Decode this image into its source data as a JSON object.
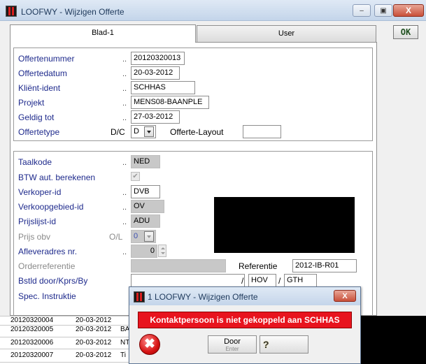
{
  "window": {
    "title": "LOOFWY - Wijzigen Offerte",
    "minimize": "–",
    "restore": "▣",
    "close": "X"
  },
  "tabs": [
    {
      "label": "Blad-1"
    },
    {
      "label": "User"
    }
  ],
  "ok_label": "OK",
  "group1": {
    "offertenummer": {
      "label": "Offertenummer",
      "value": "20120320013"
    },
    "offertedatum": {
      "label": "Offertedatum",
      "value": "20-03-2012"
    },
    "klient": {
      "label": "Kliënt-ident",
      "value": "SCHHAS"
    },
    "projekt": {
      "label": "Projekt",
      "value": "MENS08-BAANPLE"
    },
    "geldig": {
      "label": "Geldig tot",
      "value": "27-03-2012"
    },
    "offertetype": {
      "label": "Offertetype",
      "code": "D/C",
      "value": "D"
    },
    "layout": {
      "label": "Offerte-Layout",
      "value": ""
    }
  },
  "group2": {
    "taalkode": {
      "label": "Taalkode",
      "value": "NED"
    },
    "btw": {
      "label": "BTW aut. berekenen",
      "checked": "✔"
    },
    "verkoper": {
      "label": "Verkoper-id",
      "value": "DVB"
    },
    "verkoopgebied": {
      "label": "Verkoopgebied-id",
      "value": "OV"
    },
    "prijslijst": {
      "label": "Prijslijst-id",
      "value": "ADU"
    },
    "prijs_obv": {
      "label": "Prijs obv",
      "code": "O/L",
      "value": "0"
    },
    "afleveradres": {
      "label": "Afleveradres nr.",
      "value": "0"
    },
    "orderreferentie": {
      "label": "Orderreferentie",
      "value": ""
    },
    "referentie": {
      "label": "Referentie",
      "value": "2012-IB-R01"
    },
    "bstld": {
      "label": "Bstld door/Kprs/By",
      "value1": "",
      "value2": "HOV",
      "value3": "GTH"
    },
    "spec": {
      "label": "Spec. Instruktie"
    }
  },
  "dots": "..",
  "slash": "/",
  "partial_text": "",
  "background_rows": [
    {
      "nr": "20120320004",
      "date": "20-03-2012",
      "extra": ""
    },
    {
      "nr": "20120320005",
      "date": "20-03-2012",
      "extra": "BA"
    },
    {
      "nr": "20120320006",
      "date": "20-03-2012",
      "extra": "NT"
    },
    {
      "nr": "20120320007",
      "date": "20-03-2012",
      "extra": "Ti"
    }
  ],
  "dialog": {
    "title": "1 LOOFWY - Wijzigen Offerte",
    "close": "X",
    "message": "Kontaktpersoon is niet gekoppeld aan SCHHAS",
    "error_icon": "✖",
    "door_label": "Door",
    "door_sub": "Enter",
    "help_icon": "?"
  }
}
